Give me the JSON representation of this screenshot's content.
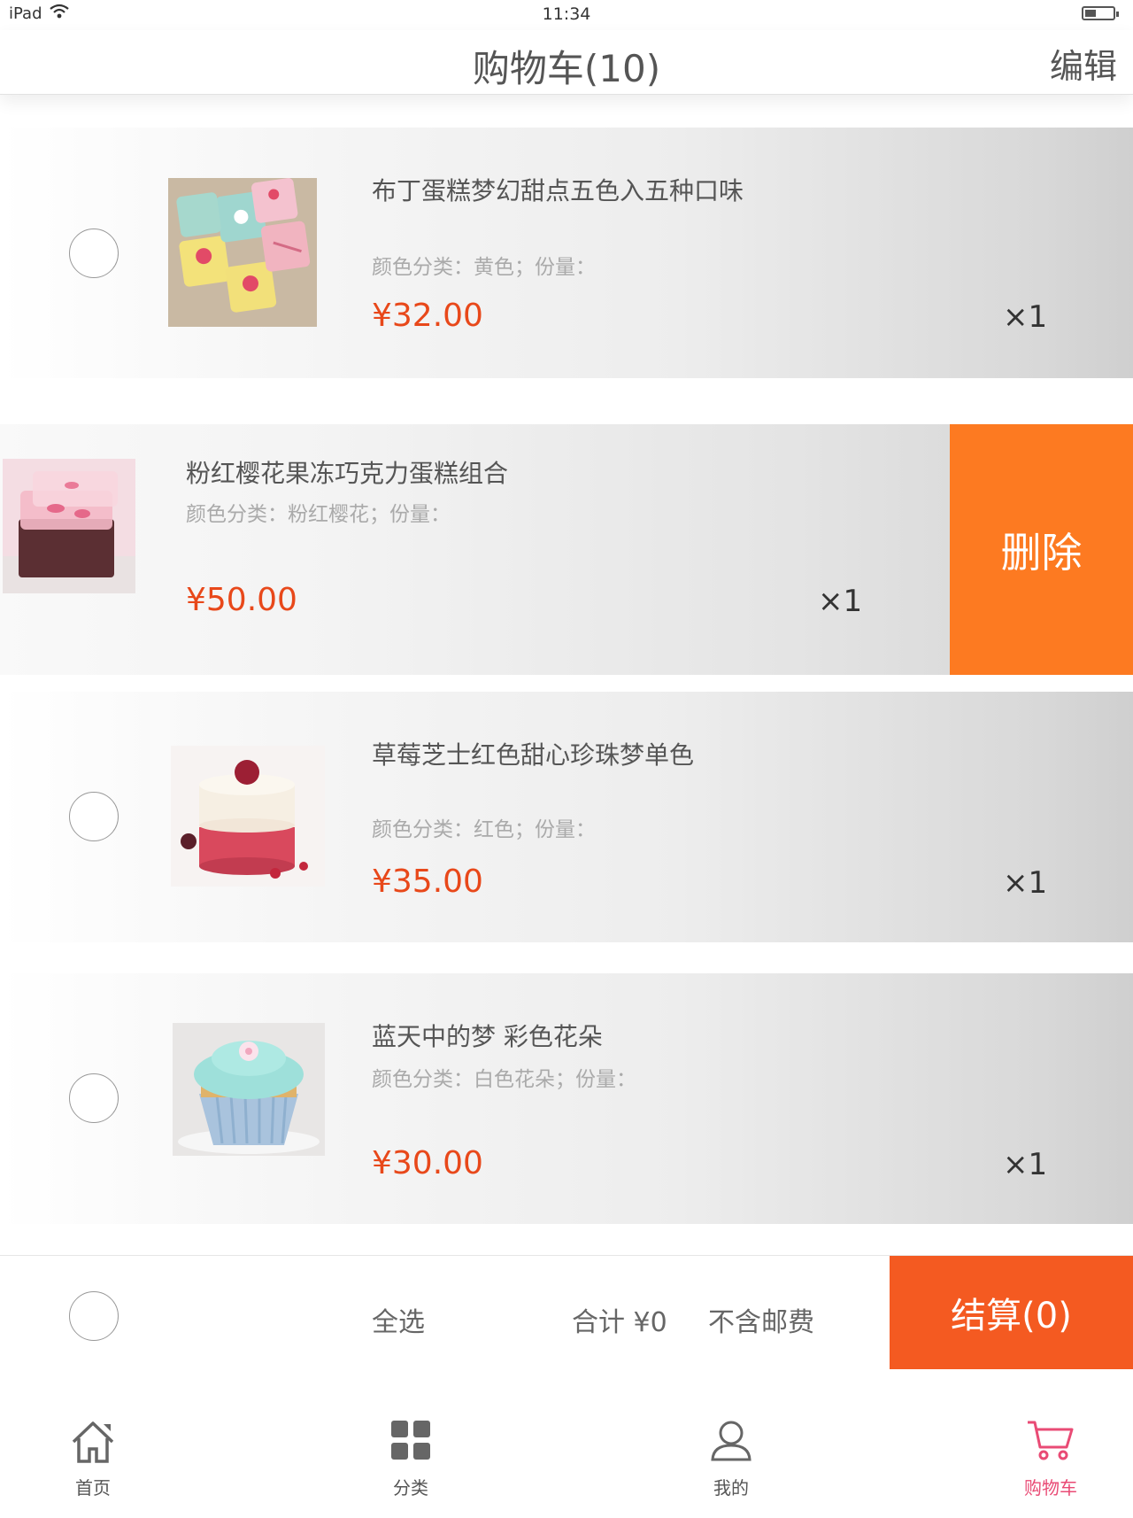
{
  "status_bar": {
    "device": "iPad",
    "time": "11:34"
  },
  "nav": {
    "title": "购物车(10)",
    "edit": "编辑"
  },
  "items": [
    {
      "name": "布丁蛋糕梦幻甜点五色入五种口味",
      "spec": "颜色分类：黄色；份量：",
      "price": "¥32.00",
      "qty": "×1",
      "thumb": "pastel-petit-fours"
    },
    {
      "name": "粉红樱花果冻巧克力蛋糕组合",
      "spec": "颜色分类：粉红樱花；份量：",
      "price": "¥50.00",
      "qty": "×1",
      "thumb": "sakura-jelly-cake"
    },
    {
      "name": "草莓芝士红色甜心珍珠梦单色",
      "spec": "颜色分类：红色；份量：",
      "price": "¥35.00",
      "qty": "×1",
      "thumb": "strawberry-mousse"
    },
    {
      "name": "蓝天中的梦  彩色花朵",
      "spec": "颜色分类：白色花朵；份量：",
      "price": "¥30.00",
      "qty": "×1",
      "thumb": "blue-cupcake"
    }
  ],
  "swipe_action": {
    "label": "删除",
    "color": "#fd7a21"
  },
  "footer": {
    "select_all": "全选",
    "total": "合计  ¥0",
    "shipping_note": "不含邮费",
    "checkout": "结算(0)",
    "checkout_color": "#f45a21"
  },
  "tabs": [
    {
      "label": "首页",
      "icon": "home-icon"
    },
    {
      "label": "分类",
      "icon": "grid-icon"
    },
    {
      "label": "我的",
      "icon": "user-icon"
    },
    {
      "label": "购物车",
      "icon": "cart-icon",
      "active": true
    }
  ],
  "colors": {
    "price": "#e8481a",
    "active_tab": "#e94b75"
  }
}
